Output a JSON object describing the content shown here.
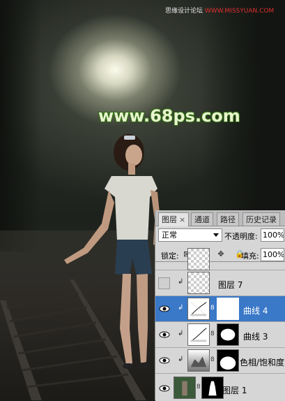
{
  "watermark": {
    "prefix": "思缘设计论坛",
    "site": "WWW.MISSYUAN.COM"
  },
  "overlay_text": "www.68ps.com",
  "panel": {
    "tabs": [
      {
        "label": "图层",
        "close": "×"
      },
      {
        "label": "通道"
      },
      {
        "label": "路径"
      },
      {
        "label": "历史记录"
      }
    ],
    "blend_mode": "正常",
    "opacity_label": "不透明度:",
    "opacity_value": "100%",
    "lock_label": "锁定:",
    "lock_icons": "⊠ ✎ ✥ 🔒",
    "fill_label": "填充:",
    "fill_value": "100%",
    "layers": [
      {
        "name": "",
        "visible": false
      },
      {
        "name": "图层 7",
        "visible": false,
        "clipped": true
      },
      {
        "name": "曲线 4",
        "visible": true,
        "clipped": true,
        "selected": true
      },
      {
        "name": "曲线 3",
        "visible": true,
        "clipped": true
      },
      {
        "name": "色相/饱和度",
        "visible": true,
        "clipped": true
      },
      {
        "name": "图层 1",
        "visible": true
      }
    ]
  },
  "colors": {
    "selection": "#3a78c8",
    "overlay_text_fill": "#e8f4d0",
    "overlay_text_outline": "#2f6b10",
    "watermark_red": "#e03030"
  }
}
